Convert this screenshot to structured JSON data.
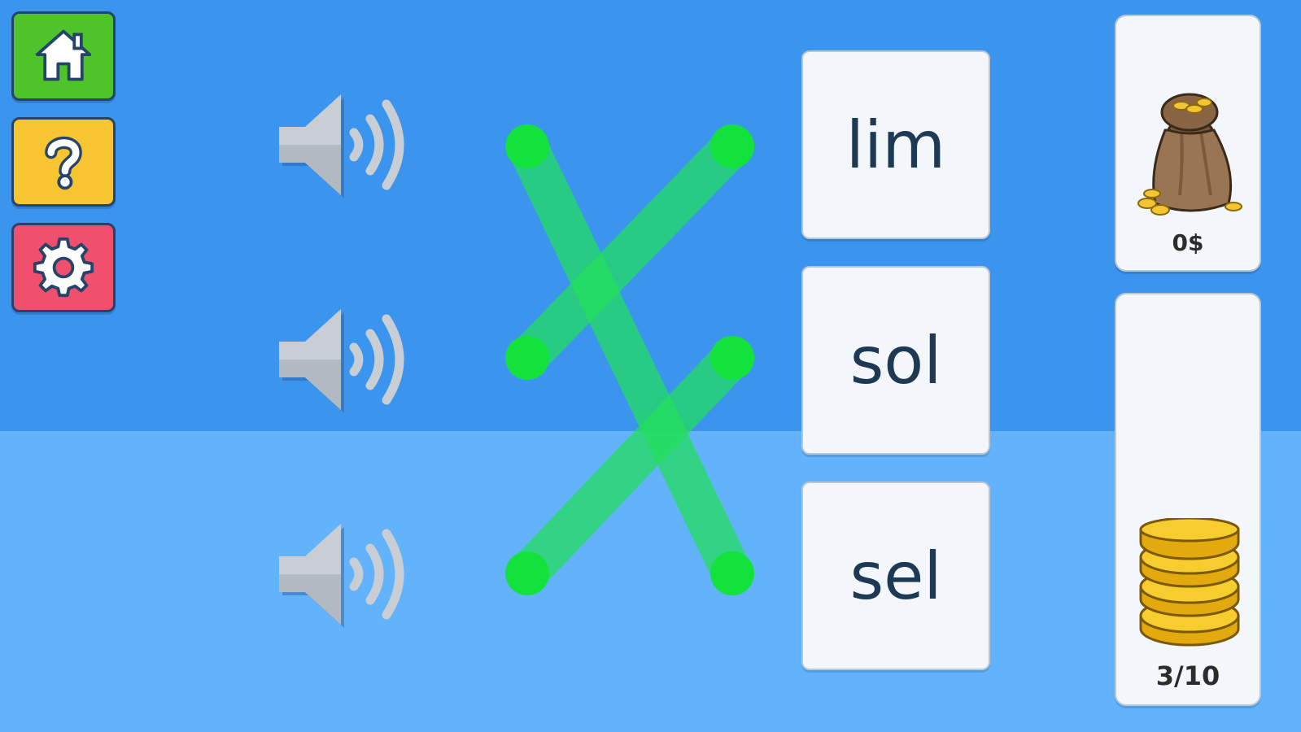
{
  "sidebar": {
    "buttons": [
      {
        "name": "home",
        "icon": "home-icon",
        "color": "#4ec42a"
      },
      {
        "name": "help",
        "icon": "question-mark-icon",
        "color": "#f7c531"
      },
      {
        "name": "settings",
        "icon": "gear-icon",
        "color": "#f0506e"
      }
    ]
  },
  "words": [
    "lim",
    "sol",
    "sel"
  ],
  "speakers": [
    {
      "icon": "speaker-icon"
    },
    {
      "icon": "speaker-icon"
    },
    {
      "icon": "speaker-icon"
    }
  ],
  "matches": [
    {
      "speaker": 1,
      "word": 3
    },
    {
      "speaker": 2,
      "word": 1
    },
    {
      "speaker": 3,
      "word": 2
    }
  ],
  "colors": {
    "line": "#22e05a",
    "dot": "#14e23c",
    "sky_top": "#3b95ee",
    "sky_bottom": "#62b3fb"
  },
  "money": {
    "label": "0$",
    "icon": "money-bag-icon"
  },
  "progress": {
    "label": "3/10",
    "current": 3,
    "total": 10,
    "icon": "coin-stack-icon"
  }
}
